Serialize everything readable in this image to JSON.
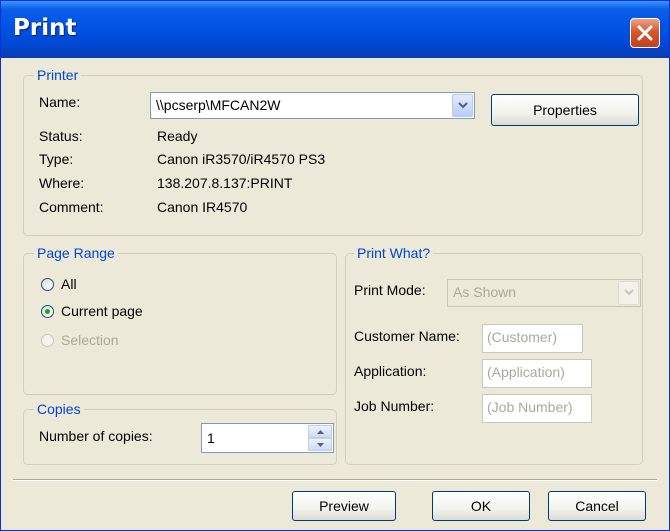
{
  "window": {
    "title": "Print"
  },
  "printer": {
    "group_title": "Printer",
    "name_label": "Name:",
    "name_value": "\\\\pcserp\\MFCAN2W",
    "properties_label": "Properties",
    "status_label": "Status:",
    "status_value": "Ready",
    "type_label": "Type:",
    "type_value": "Canon iR3570/iR4570 PS3",
    "where_label": "Where:",
    "where_value": "138.207.8.137:PRINT",
    "comment_label": "Comment:",
    "comment_value": "Canon IR4570"
  },
  "page_range": {
    "group_title": "Page Range",
    "options": [
      {
        "label": "All",
        "selected": false,
        "enabled": true
      },
      {
        "label": "Current page",
        "selected": true,
        "enabled": true
      },
      {
        "label": "Selection",
        "selected": false,
        "enabled": false
      }
    ]
  },
  "copies": {
    "group_title": "Copies",
    "label": "Number of copies:",
    "value": "1"
  },
  "print_what": {
    "group_title": "Print What?",
    "mode_label": "Print Mode:",
    "mode_value": "As Shown",
    "customer_label": "Customer Name:",
    "customer_placeholder": "(Customer)",
    "application_label": "Application:",
    "application_placeholder": "(Application)",
    "job_label": "Job Number:",
    "job_placeholder": "(Job Number)"
  },
  "buttons": {
    "preview": "Preview",
    "ok": "OK",
    "cancel": "Cancel"
  },
  "colors": {
    "titlebar": "#0055e5",
    "dialog_bg": "#ece9d8",
    "group_title": "#0046d5",
    "close": "#d5582e"
  },
  "icons": {
    "close": "close-icon",
    "dropdown": "chevron-down-icon",
    "spin_up": "spin-up-icon",
    "spin_down": "spin-down-icon"
  }
}
